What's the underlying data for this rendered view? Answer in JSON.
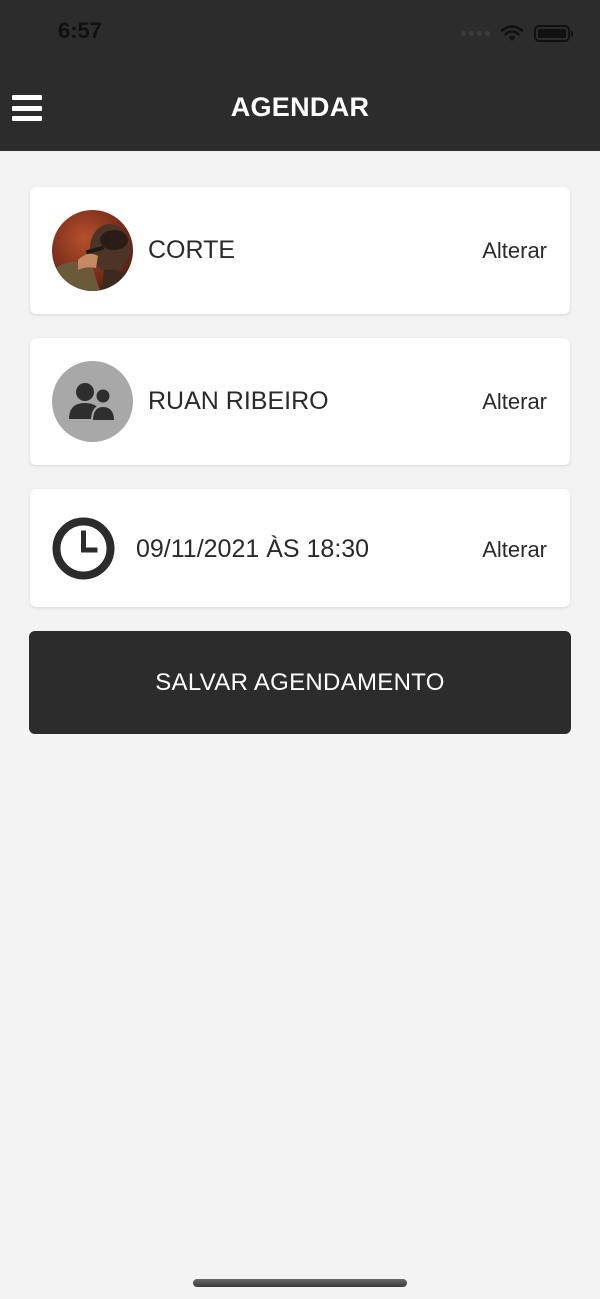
{
  "status_bar": {
    "time": "6:57",
    "icons": [
      "signal-dots-icon",
      "wifi-icon",
      "battery-icon"
    ]
  },
  "header": {
    "title": "AGENDAR",
    "menu_icon": "hamburger-menu-icon"
  },
  "booking": {
    "service": {
      "label": "CORTE",
      "action": "Alterar",
      "image": "haircut-photo"
    },
    "professional": {
      "label": "RUAN RIBEIRO",
      "action": "Alterar",
      "icon": "users-icon"
    },
    "datetime": {
      "label": "09/11/2021 ÀS 18:30",
      "action": "Alterar",
      "icon": "clock-icon"
    }
  },
  "actions": {
    "save_label": "SALVAR AGENDAMENTO"
  },
  "colors": {
    "header_bg": "#2c2c2c",
    "page_bg": "#f3f3f3",
    "card_bg": "#ffffff",
    "button_bg": "#2c2c2c",
    "text": "#2a2a2a"
  }
}
